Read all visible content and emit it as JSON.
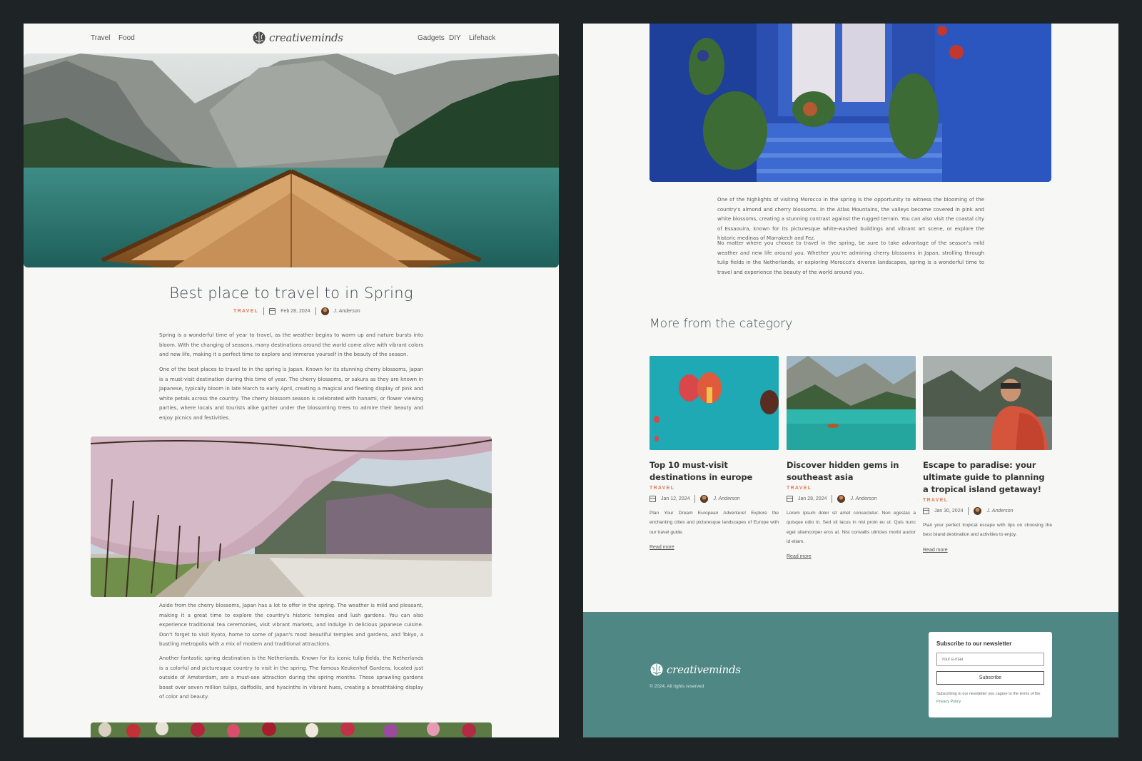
{
  "header": {
    "nav_left": [
      "Travel",
      "Food"
    ],
    "logo": "creativeminds",
    "nav_right": [
      "Gadgets",
      "DIY",
      "Lifehack"
    ]
  },
  "post": {
    "title": "Best place to travel to in Spring",
    "category": "TRAVEL",
    "date": "Feb 28, 2024",
    "author": "J. Anderson",
    "paragraphs": [
      "Spring is a wonderful time of year to travel, as the weather begins to warm up and nature bursts into bloom. With the changing of seasons, many destinations around the world come alive with vibrant colors and new life, making it a perfect time to explore and immerse yourself in the beauty of the season.",
      "One of the best places to travel to in the spring is Japan. Known for its stunning cherry blossoms, Japan is a must-visit destination during this time of year. The cherry blossoms, or sakura as they are known in Japanese, typically bloom in late March to early April, creating a magical and fleeting display of pink and white petals across the country. The cherry blossom season is celebrated with hanami, or flower viewing parties, where locals and tourists alike gather under the blossoming trees to admire their beauty and enjoy picnics and festivities.",
      "Aside from the cherry blossoms, Japan has a lot to offer in the spring. The weather is mild and pleasant, making it a great time to explore the country's historic temples and lush gardens. You can also experience traditional tea ceremonies, visit vibrant markets, and indulge in delicious Japanese cuisine. Don't forget to visit Kyoto, home to some of Japan's most beautiful temples and gardens, and Tokyo, a bustling metropolis with a mix of modern and traditional attractions.",
      "Another fantastic spring destination is the Netherlands. Known for its iconic tulip fields, the Netherlands is a colorful and picturesque country to visit in the spring. The famous Keukenhof Gardens, located just outside of Amsterdam, are a must-see attraction during the spring months. These sprawling gardens boast over seven million tulips, daffodils, and hyacinths in vibrant hues, creating a breathtaking display of color and beauty.",
      "One of the highlights of visiting Morocco in the spring is the opportunity to witness the blooming of the country's almond and cherry blossoms. In the Atlas Mountains, the valleys become covered in pink and white blossoms, creating a stunning contrast against the rugged terrain. You can also visit the coastal city of Essaouira, known for its picturesque white-washed buildings and vibrant art scene, or explore the historic medinas of Marrakech and Fez.",
      "No matter where you choose to travel in the spring, be sure to take advantage of the season's mild weather and new life around you. Whether you're admiring cherry blossoms in Japan, strolling through tulip fields in the Netherlands, or exploring Morocco's diverse landscapes, spring is a wonderful time to travel and experience the beauty of the world around you."
    ]
  },
  "more": {
    "heading": "More from the category",
    "read_more": "Read more",
    "cards": [
      {
        "title": "Top 10 must-visit destinations in europe",
        "category": "TRAVEL",
        "date": "Jan 12, 2024",
        "author": "J. Anderson",
        "excerpt": "Plan Your Dream European Adventure! Explore the enchanting cities and picturesque landscapes of Europe with our travel guide."
      },
      {
        "title": "Discover hidden gems in southeast asia",
        "category": "TRAVEL",
        "date": "Jan 28, 2024",
        "author": "J. Anderson",
        "excerpt": "Lorem ipsum dolor sit amet consectetur. Non egestas a quisque odio in. Sed sit lacus in nisl proin eu ut. Quis nunc eget ullamcorper eros at. Nisl convallis ultricies morbi auctor id etiam."
      },
      {
        "title": "Escape to paradise: your ultimate guide to planning a tropical island getaway!",
        "category": "TRAVEL",
        "date": "Jan 30, 2024",
        "author": "J. Anderson",
        "excerpt": "Plan your perfect tropical escape with tips on choosing the best island destination and activities to enjoy."
      }
    ]
  },
  "footer": {
    "logo": "creativeminds",
    "copyright": "© 2024. All rights reserved",
    "newsletter": {
      "title": "Subscribe to our newsletter",
      "placeholder": "Your e-mail",
      "button": "Subscribe",
      "terms": "Subscribing to our newsletter you cagree to the terms of the",
      "policy": "Privacy Policy"
    }
  },
  "colors": {
    "accent": "#e07b58",
    "footer_bg": "#4f8785",
    "page_bg": "#1e2326"
  }
}
